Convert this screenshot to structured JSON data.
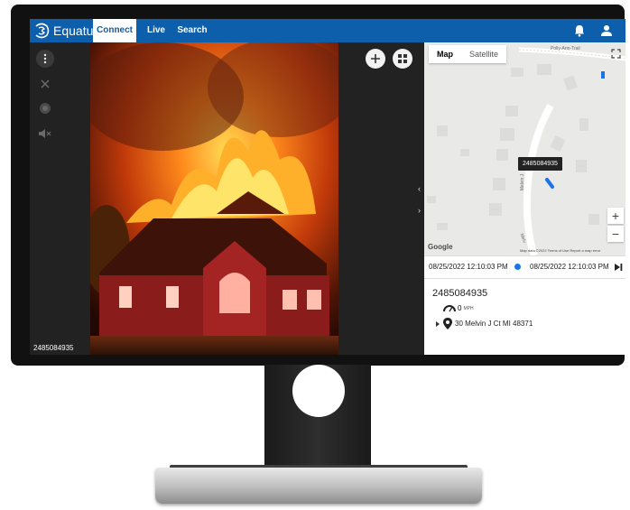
{
  "app": {
    "logo_text": "Equature",
    "nav_tabs": [
      {
        "label": "Connect",
        "active": true
      },
      {
        "label": "Live",
        "active": false
      },
      {
        "label": "Search",
        "active": false
      }
    ],
    "icons": [
      "bell-icon",
      "user-icon"
    ]
  },
  "video": {
    "side_controls": [
      "more-vertical-icon",
      "close-icon",
      "stop-icon",
      "mute-icon"
    ],
    "overlay_controls": [
      "add-icon",
      "grid-layout-icon"
    ],
    "caption": "2485084935"
  },
  "map": {
    "tabs": [
      {
        "label": "Map",
        "active": true
      },
      {
        "label": "Satellite",
        "active": false
      }
    ],
    "tooltip": "2485084935",
    "road_top": "Polly-Ann-Trail",
    "road_side": "Melvin J",
    "road_side_2": "Melv",
    "attribution": "Map data ©2022   Terms of Use   Report a map error",
    "brand": "Google",
    "zoom_in": "+",
    "zoom_out": "−"
  },
  "timeline": {
    "start": "08/25/2022 12:10:03 PM",
    "end": "08/25/2022 12:10:03 PM"
  },
  "details": {
    "device_id": "2485084935",
    "speed": "0",
    "speed_unit": "MPH",
    "address": "30 Melvin J Ct MI 48371"
  },
  "colors": {
    "header": "#0e5fab",
    "marker": "#1a73e8"
  }
}
